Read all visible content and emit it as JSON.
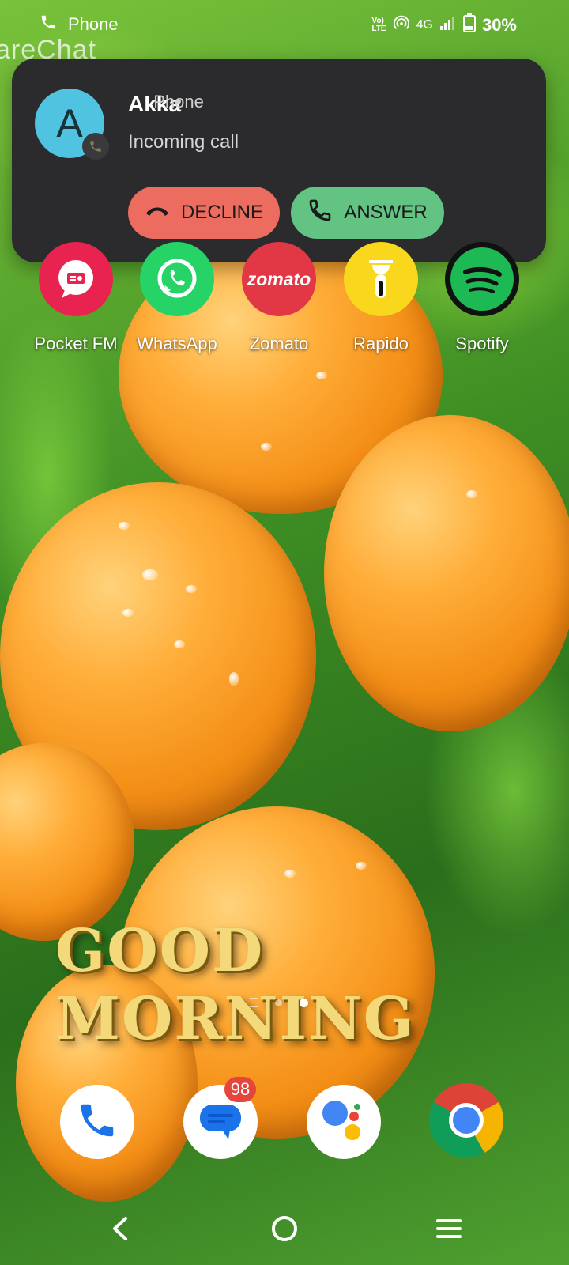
{
  "status_bar": {
    "app_label": "Phone",
    "network": "4G",
    "lte_label": "LTE",
    "volte_label": "Vo)",
    "battery": "30%"
  },
  "background_app_text": "areChat",
  "notification": {
    "caller_initial": "A",
    "caller_name": "Akka",
    "separator": "•",
    "app_name": "Phone",
    "subtitle": "Incoming call",
    "decline_label": "DECLINE",
    "answer_label": "ANSWER",
    "decline_color": "#ec6d60",
    "answer_color": "#62c383"
  },
  "apps": [
    {
      "label": "Pocket FM",
      "icon": "pocketfm-icon",
      "color": "#e8234f"
    },
    {
      "label": "WhatsApp",
      "icon": "whatsapp-icon",
      "color": "#25d366"
    },
    {
      "label": "Zomato",
      "icon": "zomato-icon",
      "color": "#e23744",
      "icon_text": "zomato"
    },
    {
      "label": "Rapido",
      "icon": "rapido-icon",
      "color": "#f9d71c"
    },
    {
      "label": "Spotify",
      "icon": "spotify-icon",
      "color": "#1db954"
    }
  ],
  "wallpaper_text": "GOOD MORNING",
  "dock": {
    "messages_badge": "98",
    "items": [
      "phone-icon",
      "messages-icon",
      "assistant-icon",
      "chrome-icon"
    ]
  },
  "nav": [
    "back-icon",
    "home-icon",
    "recents-icon"
  ]
}
